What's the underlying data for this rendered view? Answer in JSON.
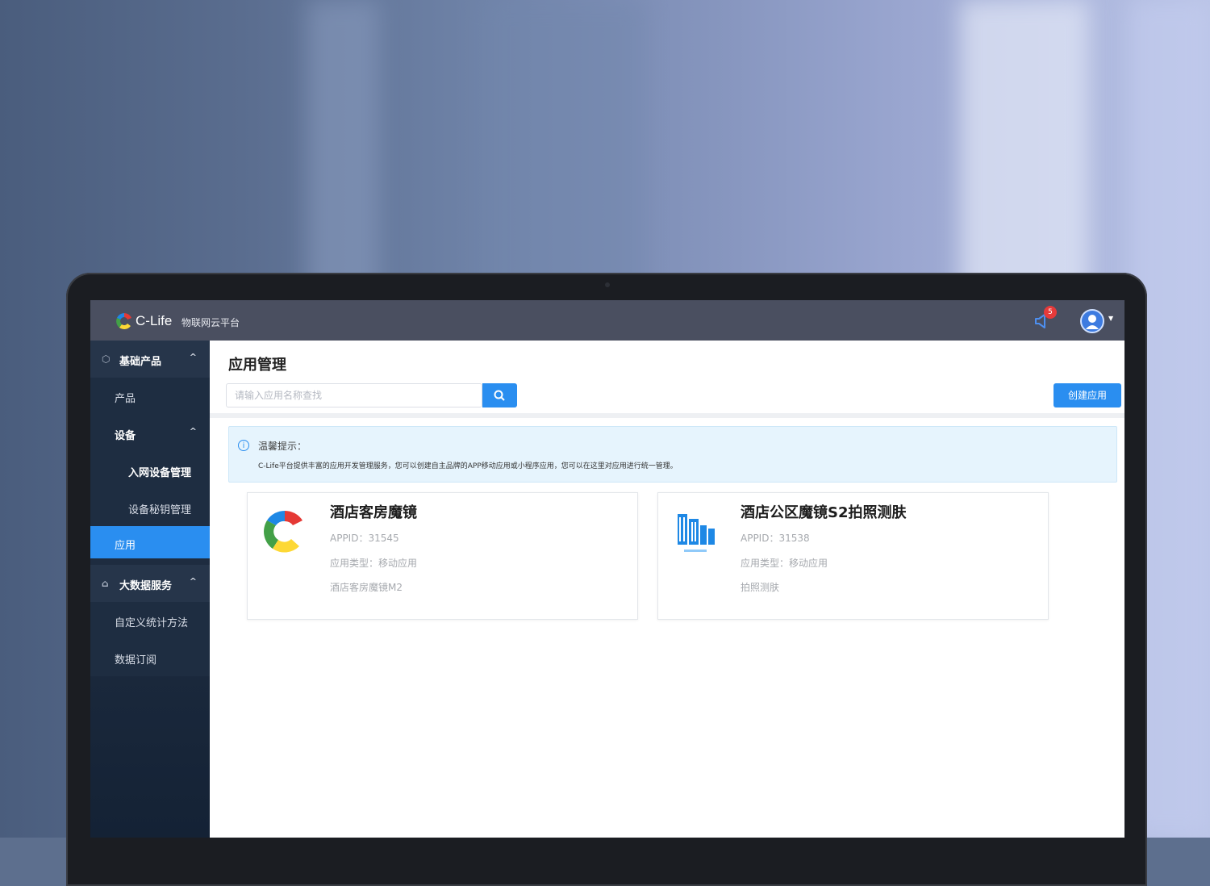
{
  "topbar": {
    "brand": "C-Life",
    "brand_sub": "物联网云平台",
    "notification_count": "5"
  },
  "sidebar": {
    "items": [
      {
        "label": "基础产品",
        "kind": "group",
        "icon": "cube-icon"
      },
      {
        "label": "产品",
        "kind": "sub"
      },
      {
        "label": "设备",
        "kind": "sub-group"
      },
      {
        "label": "入网设备管理",
        "kind": "sub2"
      },
      {
        "label": "设备秘钥管理",
        "kind": "sub2"
      },
      {
        "label": "应用",
        "kind": "active"
      },
      {
        "label": "大数据服务",
        "kind": "group",
        "icon": "bank-icon"
      },
      {
        "label": "自定义统计方法",
        "kind": "sub"
      },
      {
        "label": "数据订阅",
        "kind": "sub"
      }
    ]
  },
  "main": {
    "title": "应用管理",
    "search_placeholder": "请输入应用名称查找",
    "create_label": "创建应用",
    "tip_title": "温馨提示：",
    "tip_text": "C-Life平台提供丰富的应用开发管理服务，您可以创建自主品牌的APP移动应用或小程序应用，您可以在这里对应用进行统一管理。",
    "cards": [
      {
        "title": "酒店客房魔镜",
        "appid": "APPID：31545",
        "type": "应用类型：移动应用",
        "desc": "酒店客房魔镜M2",
        "icon": "clife-logo-icon"
      },
      {
        "title": "酒店公区魔镜S2拍照测肤",
        "appid": "APPID：31538",
        "type": "应用类型：移动应用",
        "desc": "拍照测肤",
        "icon": "building-icon"
      }
    ]
  },
  "colors": {
    "accent": "#2a8ef0",
    "sidebar_bg": "#1d2b3f",
    "topbar_bg": "#4a4f60"
  }
}
